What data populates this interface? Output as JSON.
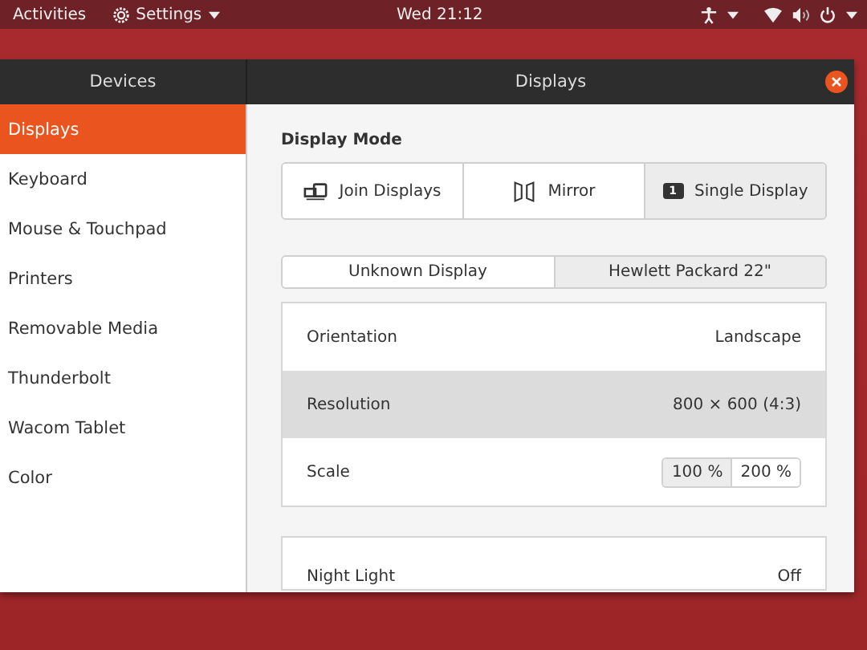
{
  "top_bar": {
    "activities": "Activities",
    "app_menu": "Settings",
    "clock": "Wed 21:12"
  },
  "window": {
    "sidebar_title": "Devices",
    "title": "Displays"
  },
  "sidebar": {
    "items": [
      {
        "label": "Displays",
        "selected": true
      },
      {
        "label": "Keyboard",
        "selected": false
      },
      {
        "label": "Mouse & Touchpad",
        "selected": false
      },
      {
        "label": "Printers",
        "selected": false
      },
      {
        "label": "Removable Media",
        "selected": false
      },
      {
        "label": "Thunderbolt",
        "selected": false
      },
      {
        "label": "Wacom Tablet",
        "selected": false
      },
      {
        "label": "Color",
        "selected": false
      }
    ]
  },
  "display_mode": {
    "heading": "Display Mode",
    "modes": [
      {
        "kind": "join",
        "label": "Join Displays",
        "selected": false
      },
      {
        "kind": "mirror",
        "label": "Mirror",
        "selected": false
      },
      {
        "kind": "single",
        "label": "Single Display",
        "badge": "1",
        "selected": true
      }
    ]
  },
  "monitors": [
    {
      "label": "Unknown Display",
      "selected": false
    },
    {
      "label": "Hewlett Packard 22\"",
      "selected": true
    }
  ],
  "settings": [
    {
      "kind": "value",
      "label": "Orientation",
      "value": "Landscape",
      "selected": false
    },
    {
      "kind": "value",
      "label": "Resolution",
      "value": "800 × 600 (4:3)",
      "selected": true
    },
    {
      "kind": "scale",
      "label": "Scale",
      "options": [
        {
          "label": "100 %",
          "selected": true
        },
        {
          "label": "200 %",
          "selected": false
        }
      ],
      "selected": false
    }
  ],
  "night_light": {
    "label": "Night Light",
    "value": "Off"
  }
}
